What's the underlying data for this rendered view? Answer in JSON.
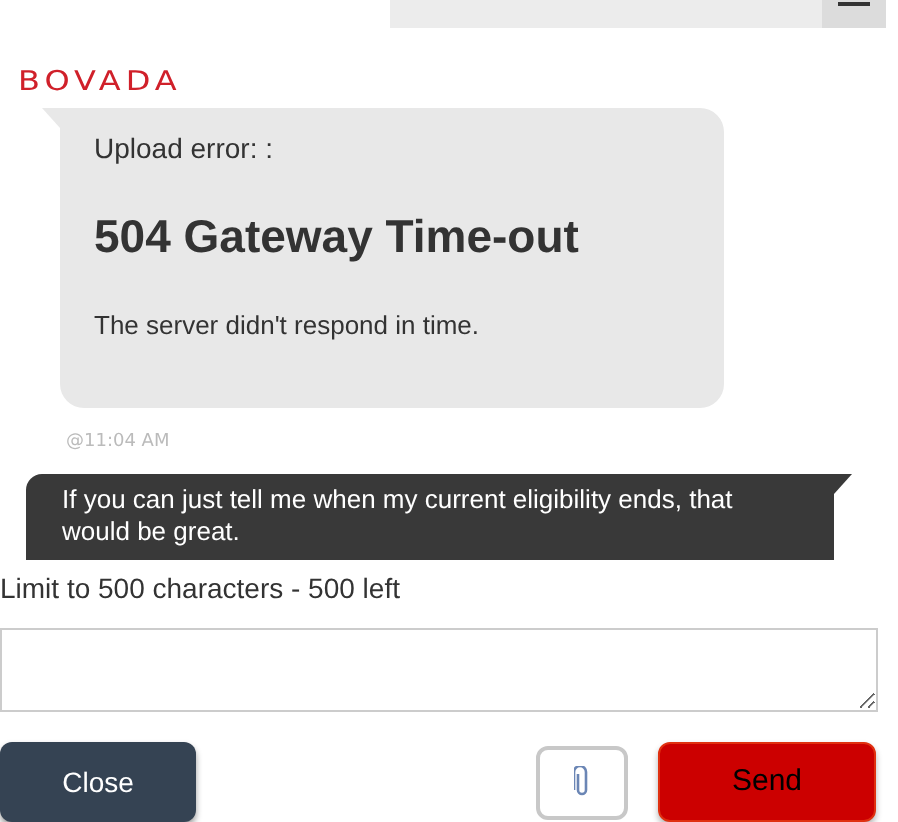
{
  "logo": "BOVADA",
  "messages": [
    {
      "kind": "agent",
      "label": "Upload error: :",
      "heading": "504 Gateway Time-out",
      "body": "The server didn't respond in time.",
      "time": "@11:04 AM"
    },
    {
      "kind": "user",
      "text": "If you can just tell me when my current eligibility ends, that would be great."
    }
  ],
  "limit": "Limit to 500 characters - 500 left",
  "buttons": {
    "close": "Close",
    "send": "Send"
  }
}
